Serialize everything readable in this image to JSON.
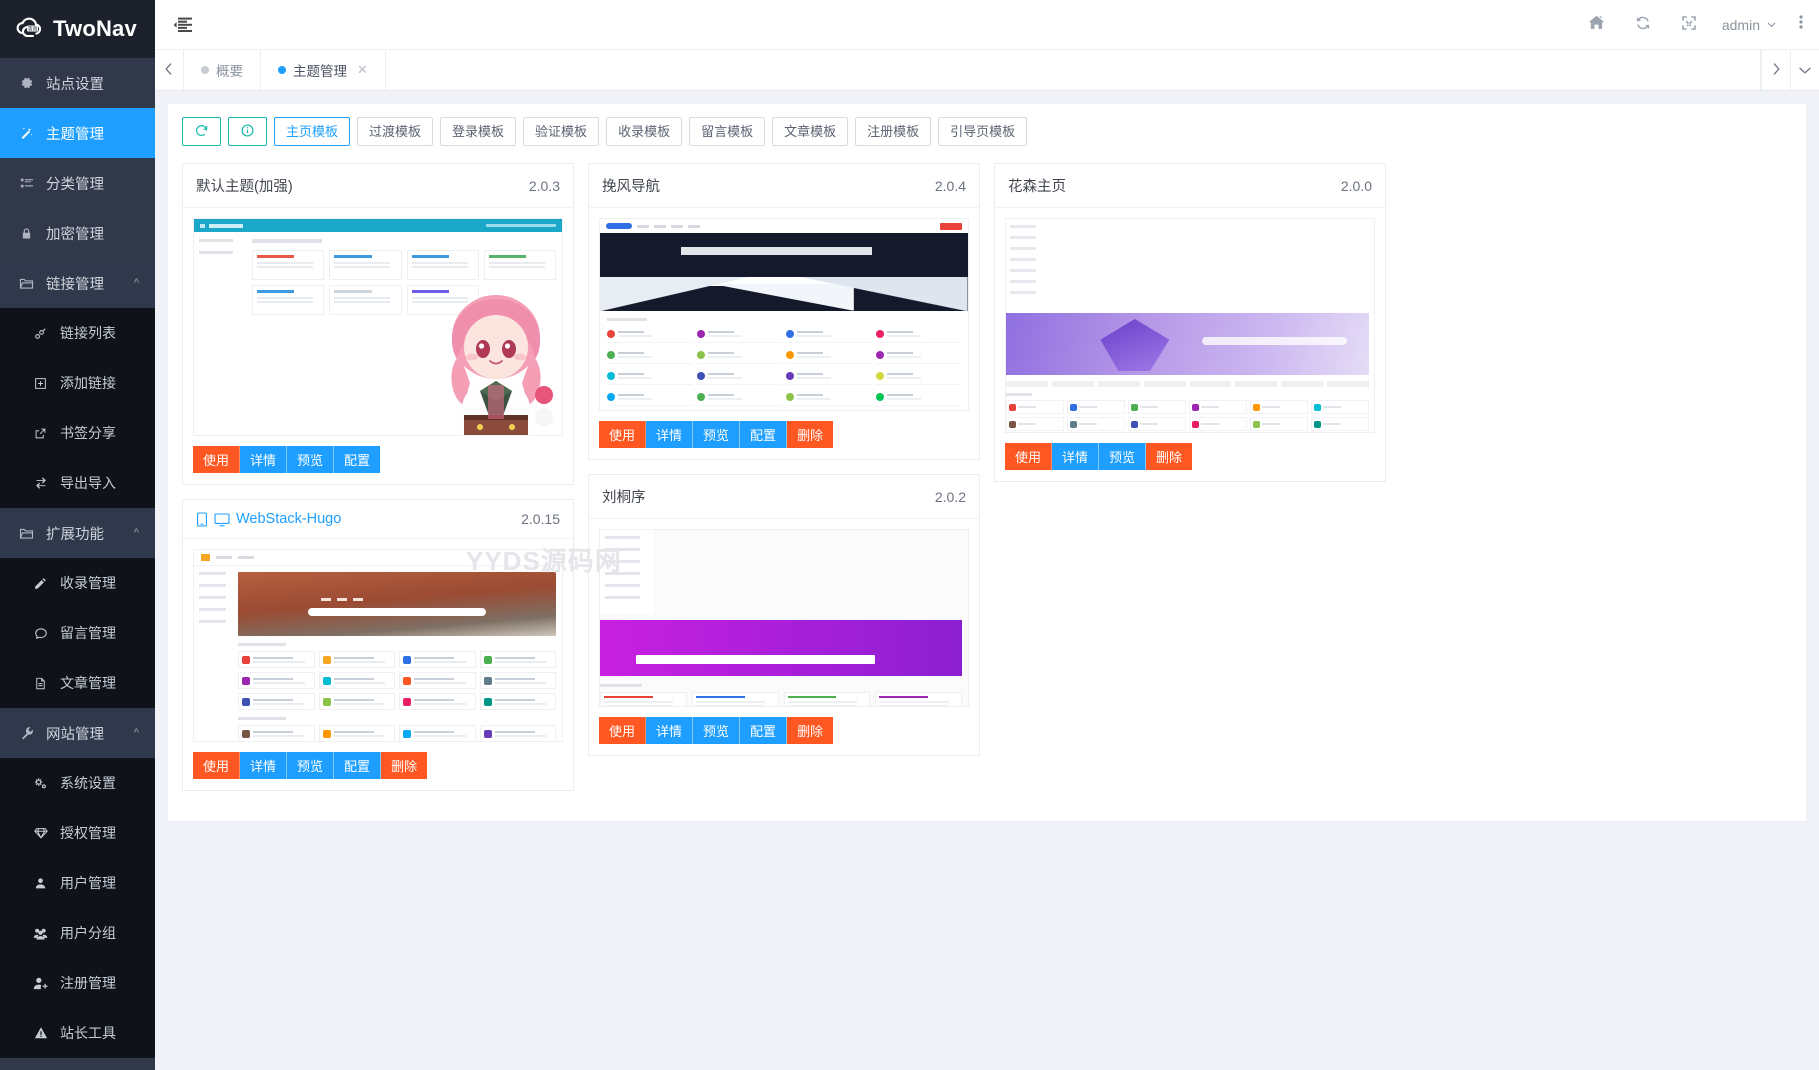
{
  "brand": {
    "name": "TwoNav",
    "logo_icon": "cloud-logo-icon"
  },
  "sidebar": {
    "items": [
      {
        "label": "站点设置",
        "icon": "gear-icon",
        "type": "item",
        "active": false
      },
      {
        "label": "主题管理",
        "icon": "magic-wand-icon",
        "type": "item",
        "active": true
      },
      {
        "label": "分类管理",
        "icon": "list-icon",
        "type": "item",
        "active": false
      },
      {
        "label": "加密管理",
        "icon": "lock-icon",
        "type": "item",
        "active": false
      },
      {
        "label": "链接管理",
        "icon": "folder-icon",
        "type": "group",
        "caret": "chevron-up-icon",
        "children": [
          {
            "label": "链接列表",
            "icon": "link-icon"
          },
          {
            "label": "添加链接",
            "icon": "plus-square-icon"
          },
          {
            "label": "书签分享",
            "icon": "external-link-icon"
          },
          {
            "label": "导出导入",
            "icon": "transfer-icon"
          }
        ]
      },
      {
        "label": "扩展功能",
        "icon": "folder-icon",
        "type": "group",
        "caret": "chevron-up-icon",
        "children": [
          {
            "label": "收录管理",
            "icon": "pencil-icon"
          },
          {
            "label": "留言管理",
            "icon": "comment-icon"
          },
          {
            "label": "文章管理",
            "icon": "document-icon"
          }
        ]
      },
      {
        "label": "网站管理",
        "icon": "wrench-icon",
        "type": "group",
        "caret": "chevron-up-icon",
        "children": [
          {
            "label": "系统设置",
            "icon": "cogs-icon"
          },
          {
            "label": "授权管理",
            "icon": "diamond-icon"
          },
          {
            "label": "用户管理",
            "icon": "user-icon"
          },
          {
            "label": "用户分组",
            "icon": "users-icon"
          },
          {
            "label": "注册管理",
            "icon": "user-plus-icon"
          },
          {
            "label": "站长工具",
            "icon": "warning-triangle-icon"
          }
        ]
      }
    ]
  },
  "topbar": {
    "menu_toggle_icon": "hamburger-indent-icon",
    "actions": [
      {
        "icon": "home-icon",
        "name": "home-button"
      },
      {
        "icon": "refresh-icon",
        "name": "refresh-button"
      },
      {
        "icon": "fullscreen-icon",
        "name": "fullscreen-button"
      }
    ],
    "user": "admin",
    "user_caret_icon": "chevron-down-icon",
    "more_icon": "vertical-dots-icon"
  },
  "tabs": {
    "left_arrow_icon": "chevron-left-icon",
    "right_arrow_icon": "chevron-right-icon",
    "dropdown_icon": "chevron-down-icon",
    "items": [
      {
        "label": "概要",
        "active": false,
        "closable": false
      },
      {
        "label": "主题管理",
        "active": true,
        "closable": true,
        "close_icon": "close-icon"
      }
    ]
  },
  "toolbar": {
    "refresh_icon": "refresh-circle-icon",
    "info_icon": "info-circle-icon",
    "filters": [
      {
        "label": "主页模板",
        "active": true
      },
      {
        "label": "过渡模板",
        "active": false
      },
      {
        "label": "登录模板",
        "active": false
      },
      {
        "label": "验证模板",
        "active": false
      },
      {
        "label": "收录模板",
        "active": false
      },
      {
        "label": "留言模板",
        "active": false
      },
      {
        "label": "文章模板",
        "active": false
      },
      {
        "label": "注册模板",
        "active": false
      },
      {
        "label": "引导页模板",
        "active": false
      }
    ]
  },
  "watermark": "YYDS源码网",
  "colors": {
    "accent_blue": "#1e9fff",
    "accent_orange": "#ff5722",
    "teal": "#16baaa",
    "sidebar_bg": "#30384a",
    "sidebar_sub_bg": "#0f1319"
  },
  "themes": [
    {
      "name": "默认主题(加强)",
      "version": "2.0.3",
      "title_is_link": false,
      "device_icons": [],
      "actions": [
        {
          "label": "使用",
          "style": "orange"
        },
        {
          "label": "详情",
          "style": "blue"
        },
        {
          "label": "预览",
          "style": "blue"
        },
        {
          "label": "配置",
          "style": "blue"
        }
      ]
    },
    {
      "name": "WebStack-Hugo",
      "version": "2.0.15",
      "title_is_link": true,
      "device_icons": [
        "mobile-icon",
        "desktop-icon"
      ],
      "actions": [
        {
          "label": "使用",
          "style": "orange"
        },
        {
          "label": "详情",
          "style": "blue"
        },
        {
          "label": "预览",
          "style": "blue"
        },
        {
          "label": "配置",
          "style": "blue"
        },
        {
          "label": "删除",
          "style": "orange"
        }
      ]
    },
    {
      "name": "挽风导航",
      "version": "2.0.4",
      "title_is_link": false,
      "device_icons": [],
      "actions": [
        {
          "label": "使用",
          "style": "orange"
        },
        {
          "label": "详情",
          "style": "blue"
        },
        {
          "label": "预览",
          "style": "blue"
        },
        {
          "label": "配置",
          "style": "blue"
        },
        {
          "label": "删除",
          "style": "orange"
        }
      ]
    },
    {
      "name": "刘桐序",
      "version": "2.0.2",
      "title_is_link": false,
      "device_icons": [],
      "actions": [
        {
          "label": "使用",
          "style": "orange"
        },
        {
          "label": "详情",
          "style": "blue"
        },
        {
          "label": "预览",
          "style": "blue"
        },
        {
          "label": "配置",
          "style": "blue"
        },
        {
          "label": "删除",
          "style": "orange"
        }
      ]
    },
    {
      "name": "花森主页",
      "version": "2.0.0",
      "title_is_link": false,
      "device_icons": [],
      "actions": [
        {
          "label": "使用",
          "style": "orange"
        },
        {
          "label": "详情",
          "style": "blue"
        },
        {
          "label": "预览",
          "style": "blue"
        },
        {
          "label": "删除",
          "style": "orange"
        }
      ]
    }
  ]
}
